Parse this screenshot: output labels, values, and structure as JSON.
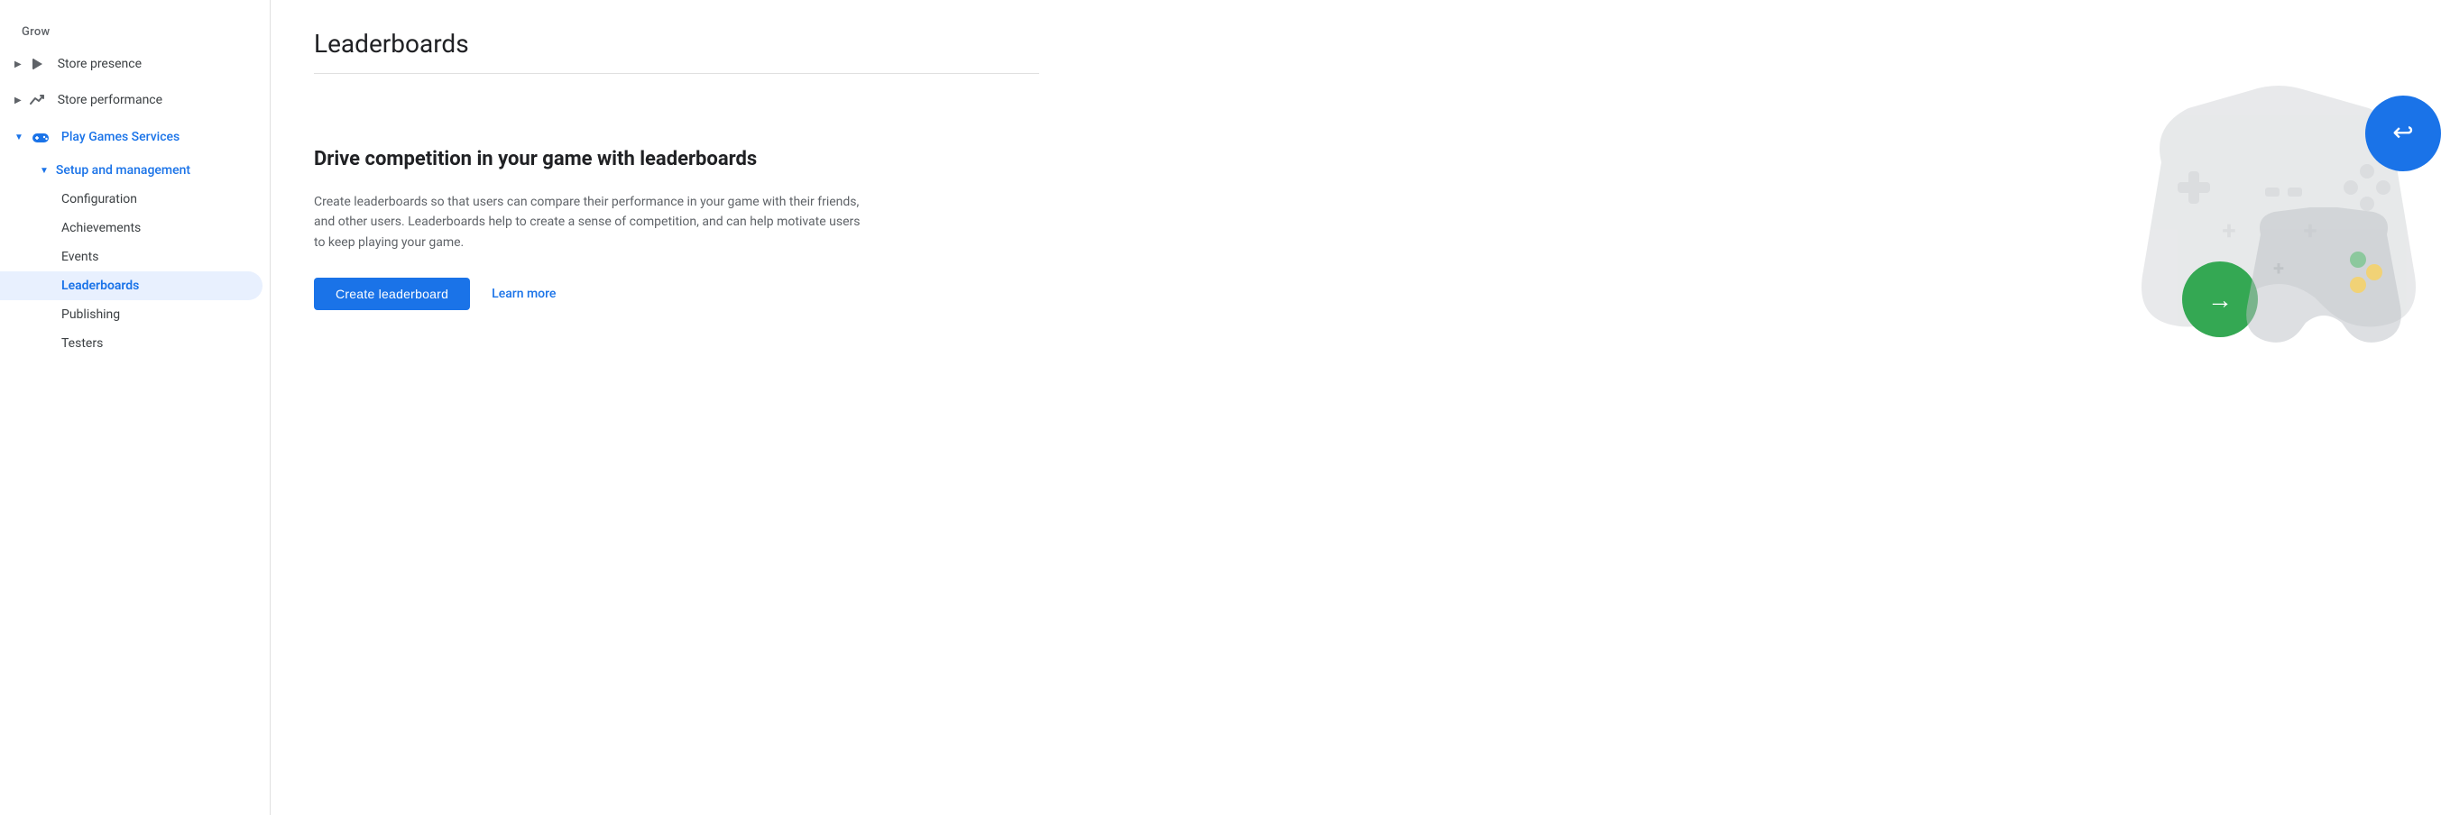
{
  "sidebar": {
    "grow_label": "Grow",
    "items": [
      {
        "id": "store-presence",
        "label": "Store presence",
        "icon": "play-icon",
        "has_arrow": true,
        "arrow_direction": "right",
        "active": false
      },
      {
        "id": "store-performance",
        "label": "Store performance",
        "icon": "trend-icon",
        "has_arrow": true,
        "arrow_direction": "right",
        "active": false
      },
      {
        "id": "play-games-services",
        "label": "Play Games Services",
        "icon": "gamepad-icon",
        "has_arrow": true,
        "arrow_direction": "down",
        "active": true,
        "blue": true
      }
    ],
    "sub_items": [
      {
        "id": "setup-management",
        "label": "Setup and management",
        "has_arrow": true,
        "arrow_direction": "down",
        "indent": 1,
        "blue": true
      },
      {
        "id": "configuration",
        "label": "Configuration",
        "indent": 2
      },
      {
        "id": "achievements",
        "label": "Achievements",
        "indent": 2
      },
      {
        "id": "events",
        "label": "Events",
        "indent": 2
      },
      {
        "id": "leaderboards",
        "label": "Leaderboards",
        "indent": 2,
        "active": true
      },
      {
        "id": "publishing",
        "label": "Publishing",
        "indent": 2
      },
      {
        "id": "testers",
        "label": "Testers",
        "indent": 2
      }
    ]
  },
  "main": {
    "page_title": "Leaderboards",
    "hero_title": "Drive competition in your game with leaderboards",
    "hero_description": "Create leaderboards so that users can compare their performance in your game with their friends, and other users. Leaderboards help to create a sense of competition, and can help motivate users to keep playing your game.",
    "create_button_label": "Create leaderboard",
    "learn_more_label": "Learn more"
  },
  "colors": {
    "blue": "#1a73e8",
    "green": "#34a853",
    "yellow": "#fbbc04",
    "light_gray": "#d0d5dd",
    "controller_gray": "#bdc1c6"
  }
}
